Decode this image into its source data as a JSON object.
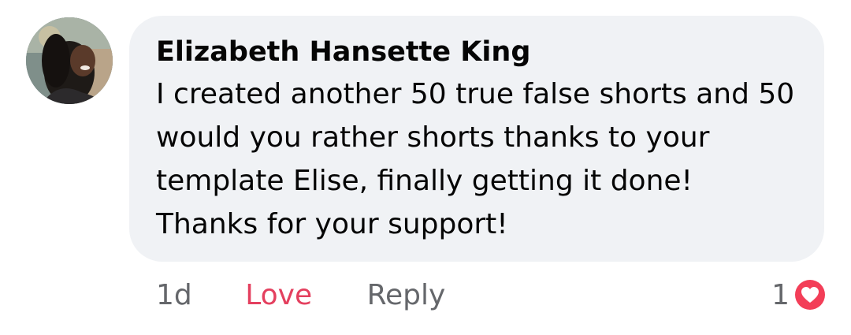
{
  "comment": {
    "author": "Elizabeth Hansette King",
    "text": "I created another 50 true false shorts and 50 would you rather shorts thanks to your template Elise, finally getting it done! Thanks for your support!",
    "avatar_icon": "user-avatar"
  },
  "actions": {
    "time": "1d",
    "love_label": "Love",
    "reply_label": "Reply"
  },
  "reactions": {
    "count": "1",
    "icon": "heart-reaction-icon",
    "colors": {
      "heart": "#f33e58",
      "love_text": "#e4405f",
      "secondary_text": "#65676b",
      "bubble": "#f0f2f5"
    }
  }
}
